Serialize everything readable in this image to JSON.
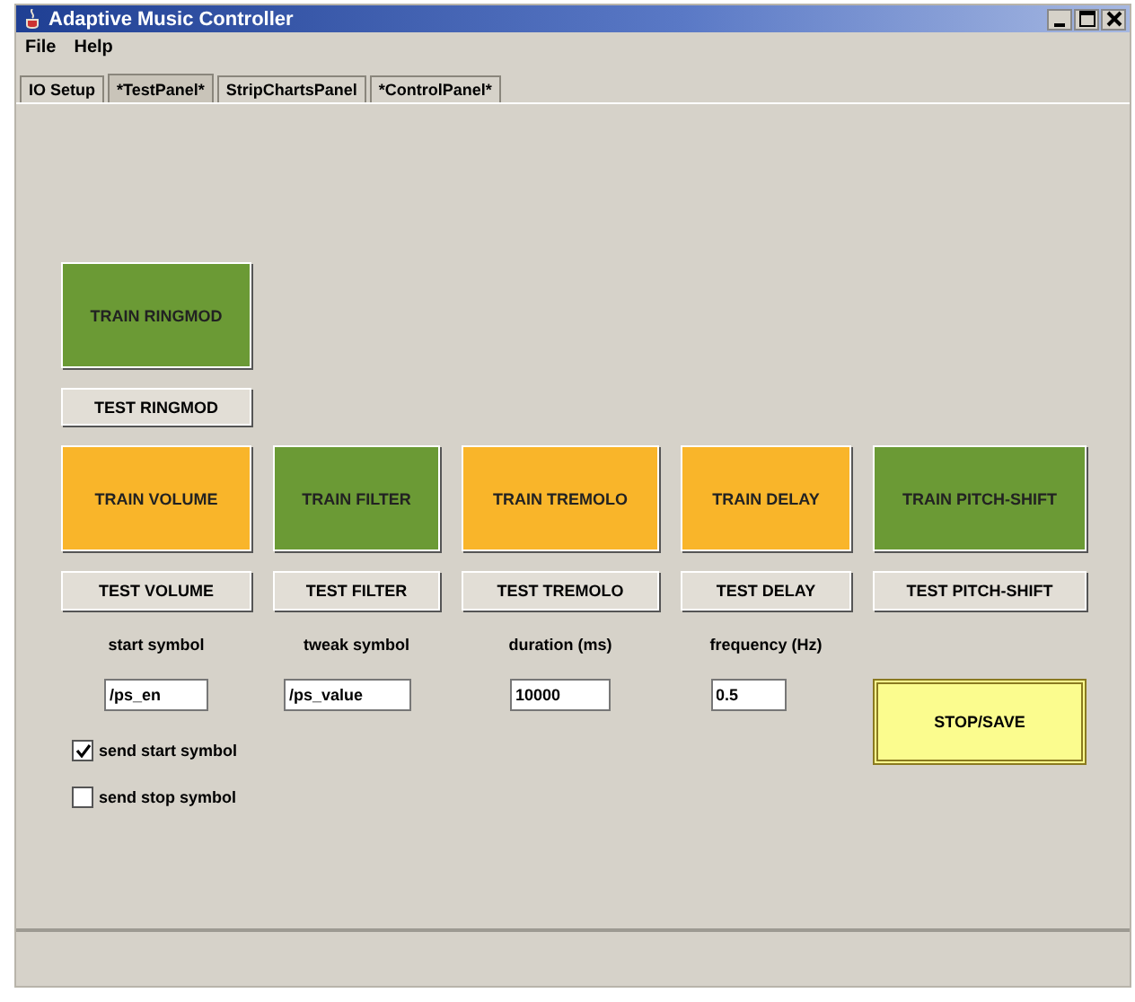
{
  "window": {
    "title": "Adaptive Music Controller"
  },
  "menu": [
    "File",
    "Help"
  ],
  "tabs": [
    {
      "label": "IO Setup",
      "selected": false
    },
    {
      "label": "*TestPanel*",
      "selected": true
    },
    {
      "label": "StripChartsPanel",
      "selected": false
    },
    {
      "label": "*ControlPanel*",
      "selected": false
    }
  ],
  "ringmod": {
    "train": "TRAIN RINGMOD",
    "color": "#6b9a35",
    "test": "TEST RINGMOD"
  },
  "effects": [
    {
      "train": "TRAIN VOLUME",
      "color": "#f9b52a",
      "test": "TEST VOLUME",
      "field_label": "start symbol",
      "field_value": "/ps_en"
    },
    {
      "train": "TRAIN FILTER",
      "color": "#6b9a35",
      "test": "TEST FILTER",
      "field_label": "tweak symbol",
      "field_value": "/ps_value"
    },
    {
      "train": "TRAIN TREMOLO",
      "color": "#f9b52a",
      "test": "TEST TREMOLO",
      "field_label": "duration (ms)",
      "field_value": "10000"
    },
    {
      "train": "TRAIN DELAY",
      "color": "#f9b52a",
      "test": "TEST DELAY",
      "field_label": "frequency (Hz)",
      "field_value": "0.5"
    },
    {
      "train": "TRAIN PITCH-SHIFT",
      "color": "#6b9a35",
      "test": "TEST PITCH-SHIFT"
    }
  ],
  "stop_button": "STOP/SAVE",
  "checkboxes": [
    {
      "label": "send start symbol",
      "checked": true
    },
    {
      "label": "send stop symbol",
      "checked": false
    }
  ]
}
